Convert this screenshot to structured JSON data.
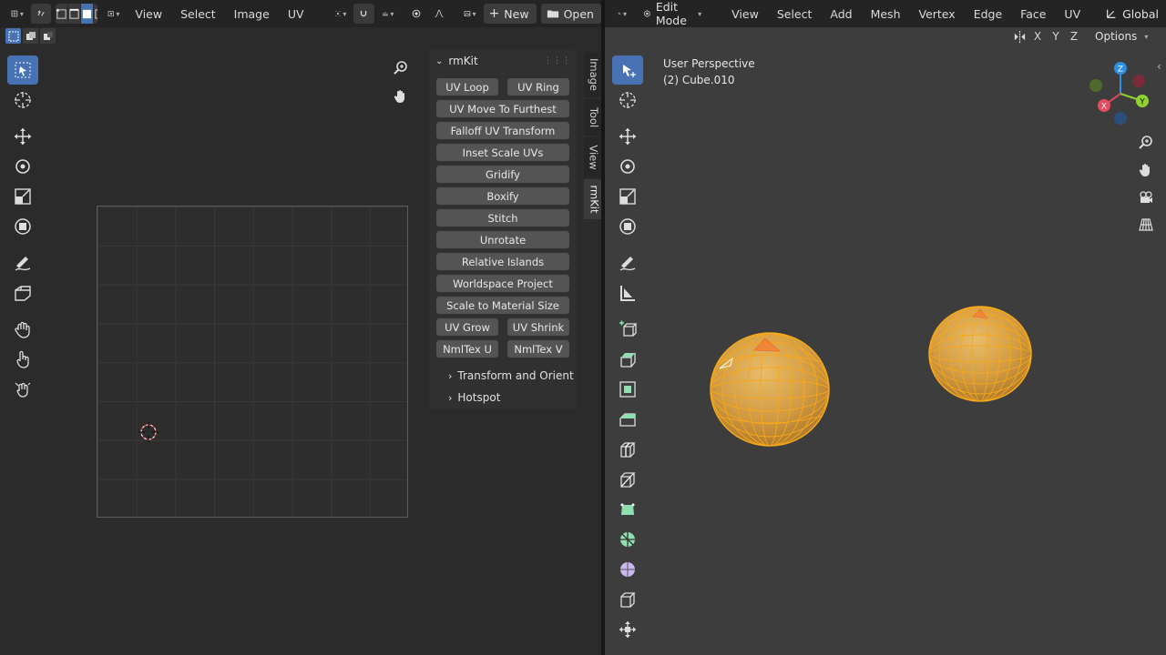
{
  "uv_header": {
    "menus": [
      "View",
      "Select",
      "Image",
      "UV"
    ],
    "new_label": "New",
    "open_label": "Open"
  },
  "npanel": {
    "title": "rmKit",
    "buttons_pair_1": [
      "UV Loop",
      "UV Ring"
    ],
    "buttons": [
      "UV Move To Furthest",
      "Falloff UV Transform",
      "Inset Scale UVs",
      "Gridify",
      "Boxify",
      "Stitch",
      "Unrotate",
      "Relative Islands",
      "Worldspace Project",
      "Scale to Material Size"
    ],
    "buttons_pair_2": [
      "UV Grow",
      "UV Shrink"
    ],
    "buttons_pair_3": [
      "NmlTex U",
      "NmlTex V"
    ],
    "subpanels": [
      "Transform and Orient",
      "Hotspot"
    ],
    "tabs": [
      "Image",
      "Tool",
      "View",
      "rmKit"
    ],
    "active_tab": "rmKit"
  },
  "viewport_header": {
    "mode_label": "Edit Mode",
    "menus": [
      "View",
      "Select",
      "Add",
      "Mesh",
      "Vertex",
      "Edge",
      "Face",
      "UV"
    ],
    "orientation_label": "Global",
    "axes": [
      "X",
      "Y",
      "Z"
    ],
    "options_label": "Options"
  },
  "viewport": {
    "view_name": "User Perspective",
    "object_label": "(2) Cube.010"
  },
  "colors": {
    "accent": "#4772b3",
    "mesh_fill": "#d9a54a",
    "mesh_wire": "#f2a21a",
    "selected": "#ff5a1f",
    "axis_x": "#e84a5f",
    "axis_y": "#8fd12f",
    "axis_z": "#2f8fe0"
  }
}
